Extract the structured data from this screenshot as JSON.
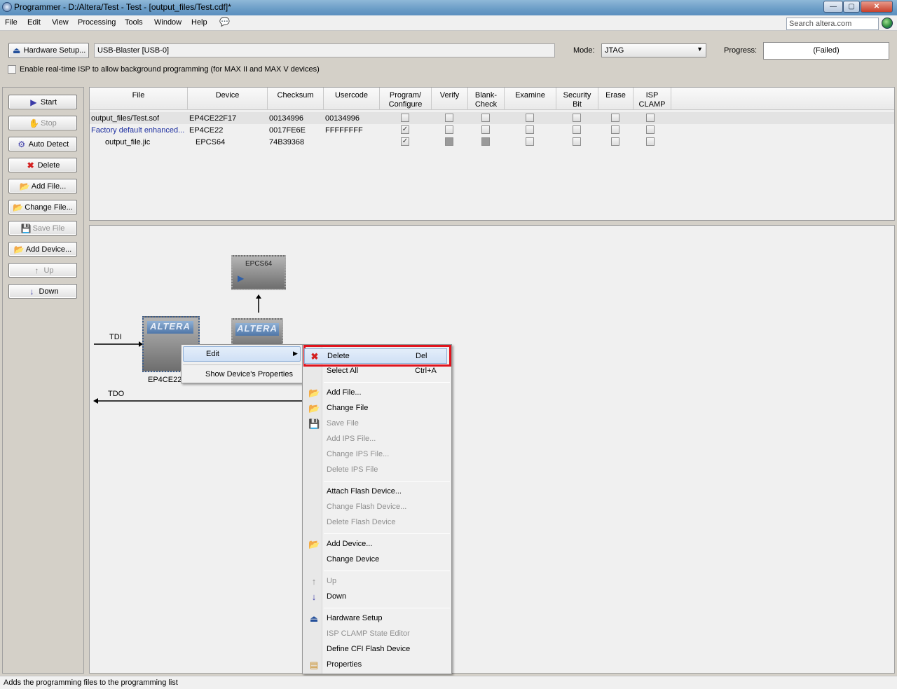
{
  "window": {
    "title": "Programmer - D:/Altera/Test - Test - [output_files/Test.cdf]*",
    "min": "—",
    "max": "▢",
    "close": "✕"
  },
  "menubar": {
    "items": [
      "File",
      "Edit",
      "View",
      "Processing",
      "Tools",
      "Window",
      "Help"
    ],
    "search_placeholder": "Search altera.com"
  },
  "toolbar": {
    "hardware_setup_label": "Hardware Setup...",
    "hardware_value": "USB-Blaster [USB-0]",
    "mode_label": "Mode:",
    "mode_value": "JTAG",
    "progress_label": "Progress:",
    "progress_value": "(Failed)",
    "isp_label": "Enable real-time ISP to allow background programming (for MAX II and MAX V devices)"
  },
  "left_buttons": {
    "start": "Start",
    "stop": "Stop",
    "auto_detect": "Auto Detect",
    "delete": "Delete",
    "add_file": "Add File...",
    "change_file": "Change File...",
    "save_file": "Save File",
    "add_device": "Add Device...",
    "up": "Up",
    "down": "Down"
  },
  "table": {
    "headers": {
      "file": "File",
      "device": "Device",
      "checksum": "Checksum",
      "usercode": "Usercode",
      "program_1": "Program/",
      "program_2": "Configure",
      "verify": "Verify",
      "blank_1": "Blank-",
      "blank_2": "Check",
      "examine": "Examine",
      "security_1": "Security",
      "security_2": "Bit",
      "erase": "Erase",
      "isp_1": "ISP",
      "isp_2": "CLAMP"
    },
    "rows": [
      {
        "file": "output_files/Test.sof",
        "device": "EP4CE22F17",
        "checksum": "00134996",
        "usercode": "00134996"
      },
      {
        "file": "Factory default enhanced...",
        "device": "EP4CE22",
        "checksum": "0017FE6E",
        "usercode": "FFFFFFFF"
      },
      {
        "file": "output_file.jic",
        "device": "EPCS64",
        "checksum": "74B39368",
        "usercode": ""
      }
    ]
  },
  "canvas": {
    "tdi": "TDI",
    "tdo": "TDO",
    "epcs_label": "EPCS64",
    "chip_label": "EP4CE22F",
    "logo": "ALTERA"
  },
  "context_menu": {
    "edit": "Edit",
    "show_props": "Show Device's Properties"
  },
  "edit_submenu": {
    "delete": "Delete",
    "delete_sc": "Del",
    "select_all": "Select All",
    "select_all_sc": "Ctrl+A",
    "add_file": "Add File...",
    "change_file": "Change File",
    "save_file": "Save File",
    "add_ips": "Add IPS File...",
    "change_ips": "Change IPS File...",
    "delete_ips": "Delete IPS File",
    "attach_flash": "Attach Flash Device...",
    "change_flash": "Change Flash Device...",
    "delete_flash": "Delete Flash Device",
    "add_device": "Add Device...",
    "change_device": "Change Device",
    "up": "Up",
    "down": "Down",
    "hardware_setup": "Hardware Setup",
    "isp_clamp": "ISP CLAMP State Editor",
    "define_cfi": "Define CFI Flash Device",
    "properties": "Properties"
  },
  "status": {
    "text": "Adds the programming files to the programming list"
  },
  "colors": {
    "highlight_box": "#e0141e",
    "link_blue": "#1e2fa0",
    "delete_red": "#d42020"
  }
}
